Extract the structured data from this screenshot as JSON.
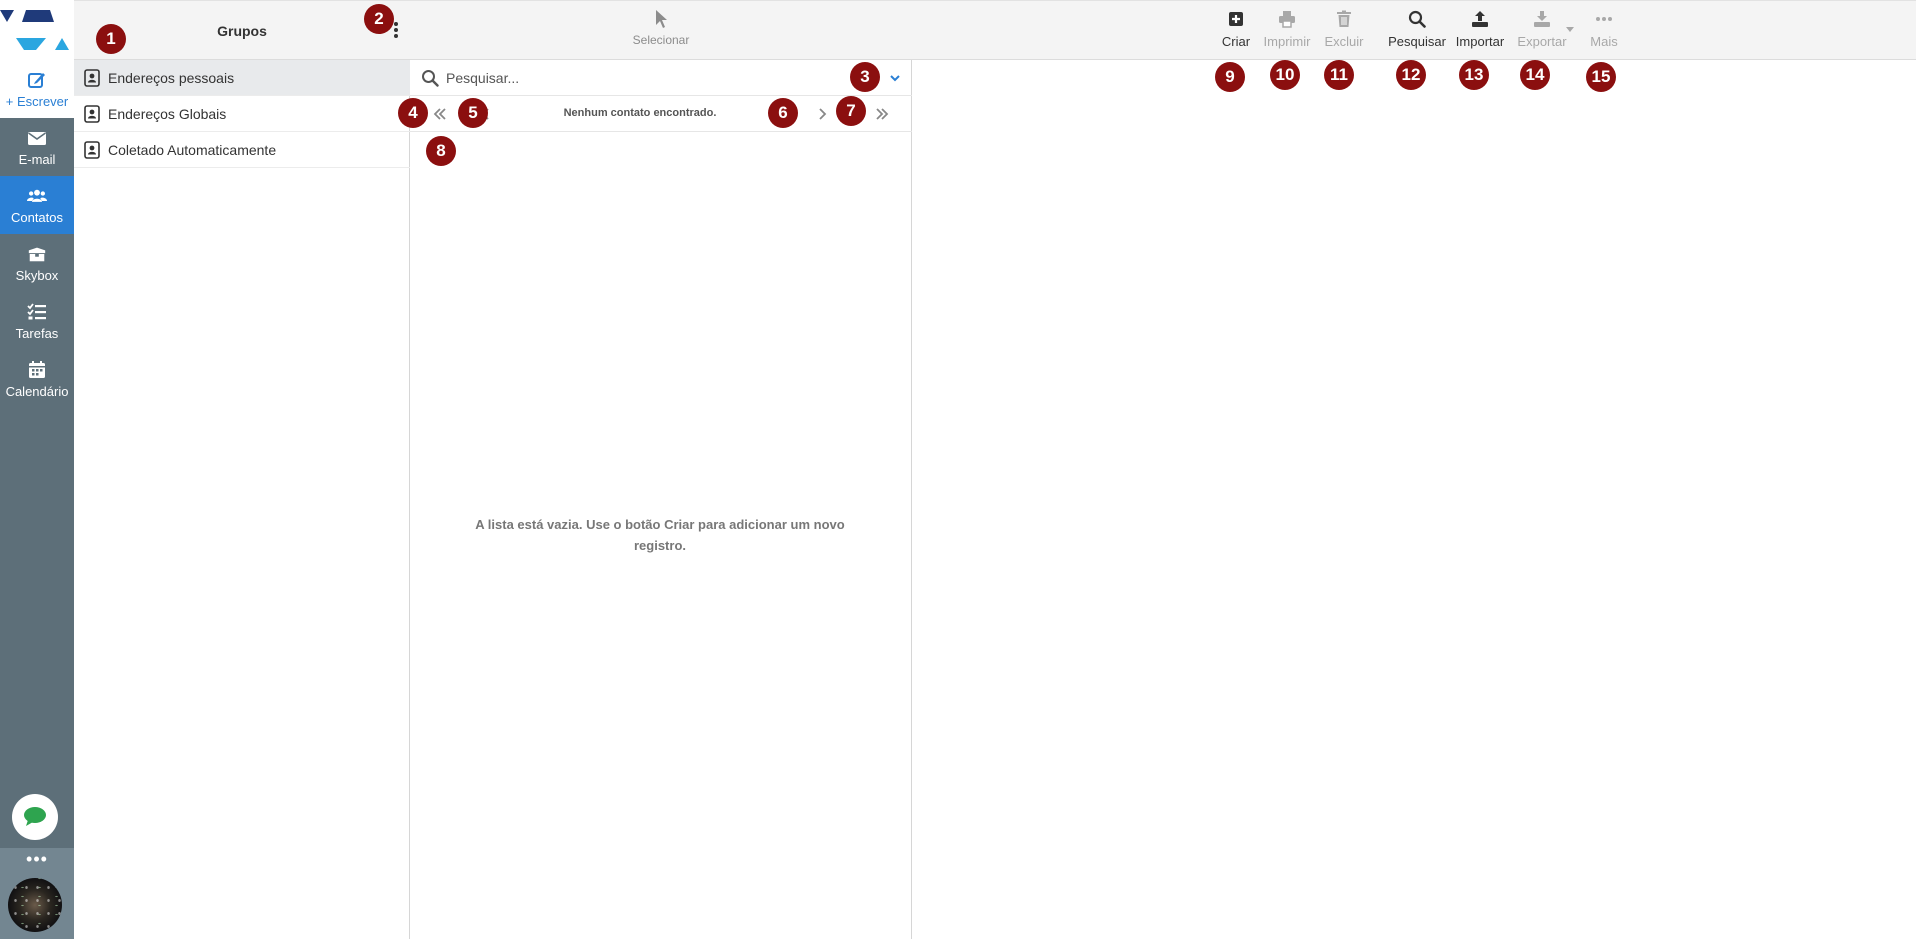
{
  "rail": {
    "items": [
      {
        "label": "+ Escrever",
        "icon": "pencil-square-icon"
      },
      {
        "label": "E-mail",
        "icon": "envelope-icon"
      },
      {
        "label": "Contatos",
        "icon": "users-icon"
      },
      {
        "label": "Skybox",
        "icon": "box-icon"
      },
      {
        "label": "Tarefas",
        "icon": "task-list-icon"
      },
      {
        "label": "Calendário",
        "icon": "calendar-icon"
      }
    ],
    "more": "•••",
    "chat_icon": "chat-bubble-icon"
  },
  "groups": {
    "title": "Grupos",
    "items": [
      {
        "label": "Endereços pessoais",
        "selected": true
      },
      {
        "label": "Endereços Globais",
        "selected": false
      },
      {
        "label": "Coletado Automaticamente",
        "selected": false
      }
    ]
  },
  "list": {
    "select_label": "Selecionar",
    "search_placeholder": "Pesquisar...",
    "pager_text": "Nenhum contato encontrado.",
    "empty_message": "A lista está vazia. Use o botão Criar para adicionar um novo registro."
  },
  "toolbar": {
    "criar": "Criar",
    "imprimir": "Imprimir",
    "excluir": "Excluir",
    "pesquisar": "Pesquisar",
    "importar": "Importar",
    "exportar": "Exportar",
    "mais": "Mais"
  },
  "markers": [
    "1",
    "2",
    "3",
    "4",
    "5",
    "6",
    "7",
    "8",
    "9",
    "10",
    "11",
    "12",
    "13",
    "14",
    "15"
  ],
  "colors": {
    "accent": "#2a7fd4",
    "rail": "#5d6f79",
    "marker": "#8b0f0f",
    "logo_dark": "#1f3a7a",
    "logo_light": "#2aa6e0"
  }
}
